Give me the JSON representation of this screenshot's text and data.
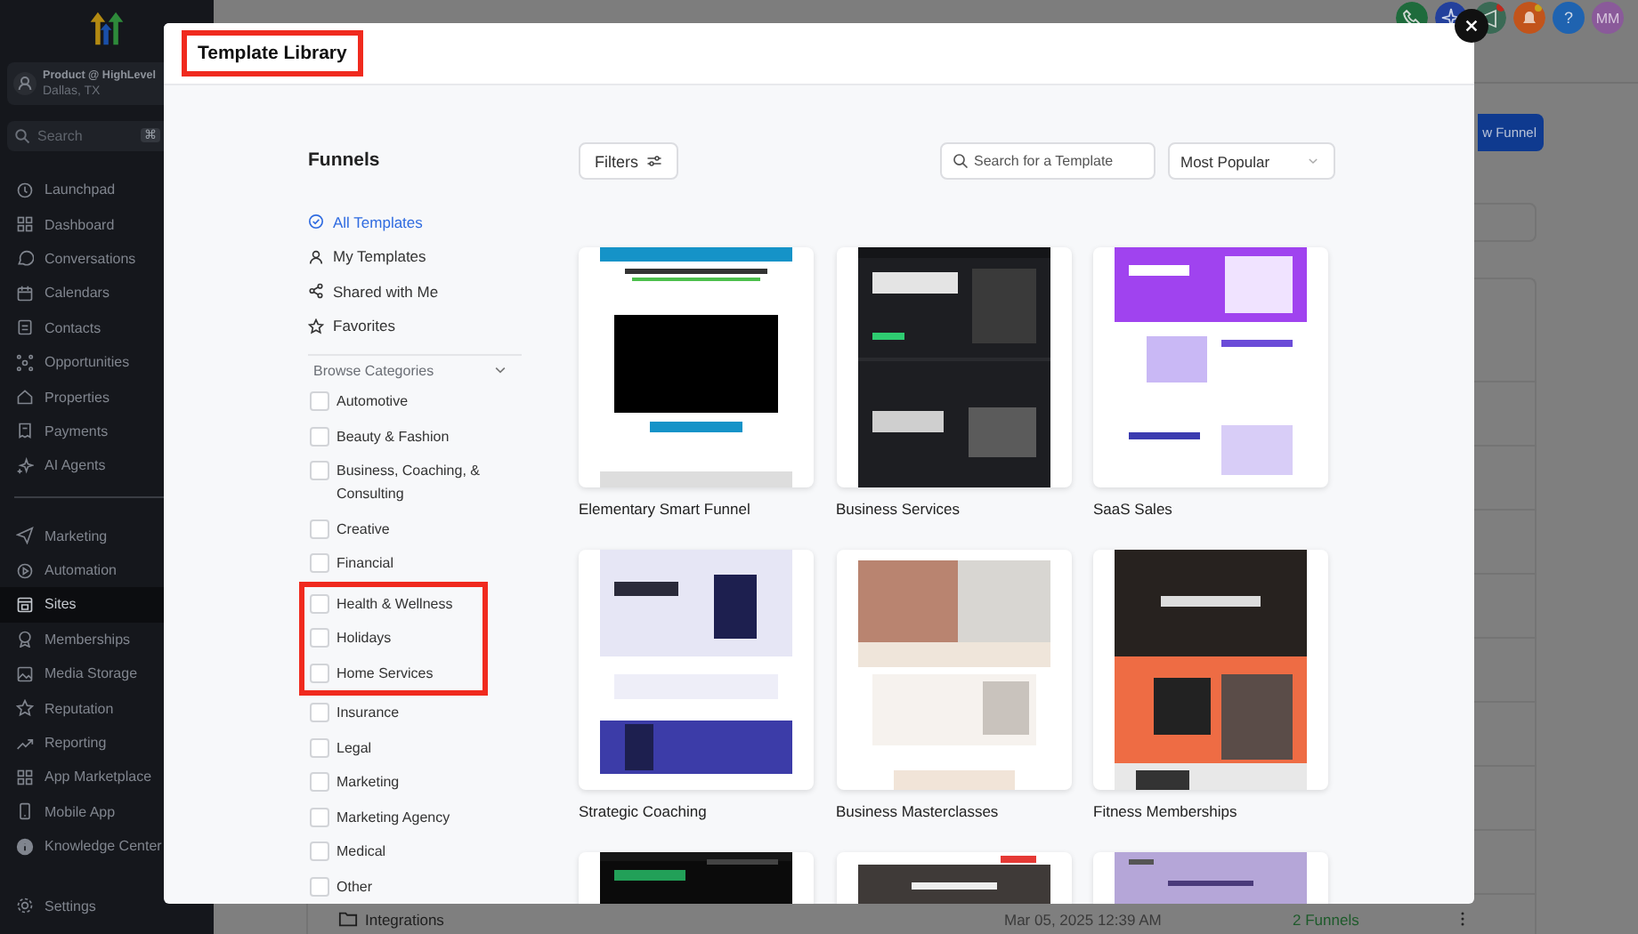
{
  "sidebar": {
    "account": {
      "name": "Product @ HighLevel",
      "location": "Dallas, TX"
    },
    "search": {
      "placeholder": "Search",
      "shortcut": "⌘"
    },
    "groups": [
      [
        {
          "label": "Launchpad",
          "selected": false
        },
        {
          "label": "Dashboard",
          "selected": false
        },
        {
          "label": "Conversations",
          "selected": false
        },
        {
          "label": "Calendars",
          "selected": false
        },
        {
          "label": "Contacts",
          "selected": false
        },
        {
          "label": "Opportunities",
          "selected": false
        },
        {
          "label": "Properties",
          "selected": false
        },
        {
          "label": "Payments",
          "selected": false
        },
        {
          "label": "AI Agents",
          "selected": false
        }
      ],
      [
        {
          "label": "Marketing",
          "selected": false
        },
        {
          "label": "Automation",
          "selected": false
        },
        {
          "label": "Sites",
          "selected": true
        },
        {
          "label": "Memberships",
          "selected": false
        },
        {
          "label": "Media Storage",
          "selected": false
        },
        {
          "label": "Reputation",
          "selected": false
        },
        {
          "label": "Reporting",
          "selected": false
        },
        {
          "label": "App Marketplace",
          "selected": false
        },
        {
          "label": "Mobile App",
          "selected": false
        },
        {
          "label": "Knowledge Center",
          "selected": false
        }
      ]
    ],
    "footer": {
      "label": "Settings",
      "selected": false
    }
  },
  "topbar": {
    "help": "?",
    "avatar": "MM"
  },
  "page": {
    "new_button": "w Funnel",
    "last_row": {
      "name": "Integrations",
      "date": "Mar 05, 2025 12:39 AM",
      "count": "2 Funnels"
    }
  },
  "modal": {
    "title": "Template Library",
    "title_highlighted": true,
    "heading": "Funnels",
    "nav": [
      {
        "label": "All Templates",
        "selected": true
      },
      {
        "label": "My Templates",
        "selected": false
      },
      {
        "label": "Shared with Me",
        "selected": false
      },
      {
        "label": "Favorites",
        "selected": false
      }
    ],
    "categories_header": {
      "label": "Browse Categories",
      "expanded": true
    },
    "categories": [
      {
        "label": "Automotive",
        "checked": false,
        "highlighted": false
      },
      {
        "label": "Beauty & Fashion",
        "checked": false,
        "highlighted": false
      },
      {
        "label": "Business, Coaching, & Consulting",
        "checked": false,
        "highlighted": false
      },
      {
        "label": "Creative",
        "checked": false,
        "highlighted": false
      },
      {
        "label": "Financial",
        "checked": false,
        "highlighted": false
      },
      {
        "label": "Health & Wellness",
        "checked": false,
        "highlighted": true
      },
      {
        "label": "Holidays",
        "checked": false,
        "highlighted": true
      },
      {
        "label": "Home Services",
        "checked": false,
        "highlighted": true
      },
      {
        "label": "Insurance",
        "checked": false,
        "highlighted": false
      },
      {
        "label": "Legal",
        "checked": false,
        "highlighted": false
      },
      {
        "label": "Marketing",
        "checked": false,
        "highlighted": false
      },
      {
        "label": "Marketing Agency",
        "checked": false,
        "highlighted": false
      },
      {
        "label": "Medical",
        "checked": false,
        "highlighted": false
      },
      {
        "label": "Other",
        "checked": false,
        "highlighted": false
      }
    ],
    "filters": "Filters",
    "search": {
      "placeholder": "Search for a Template"
    },
    "sort": {
      "value": "Most Popular"
    },
    "templates": [
      {
        "name": "Elementary Smart Funnel",
        "kind": "picture"
      },
      {
        "name": "Business Services",
        "kind": "picture"
      },
      {
        "name": "SaaS Sales",
        "kind": "picture"
      },
      {
        "name": "Strategic Coaching",
        "kind": "picture"
      },
      {
        "name": "Business Masterclasses",
        "kind": "picture"
      },
      {
        "name": "Fitness Memberships",
        "kind": "picture"
      },
      {
        "kind": "picture"
      },
      {
        "kind": "picture"
      },
      {
        "kind": "picture"
      }
    ]
  }
}
